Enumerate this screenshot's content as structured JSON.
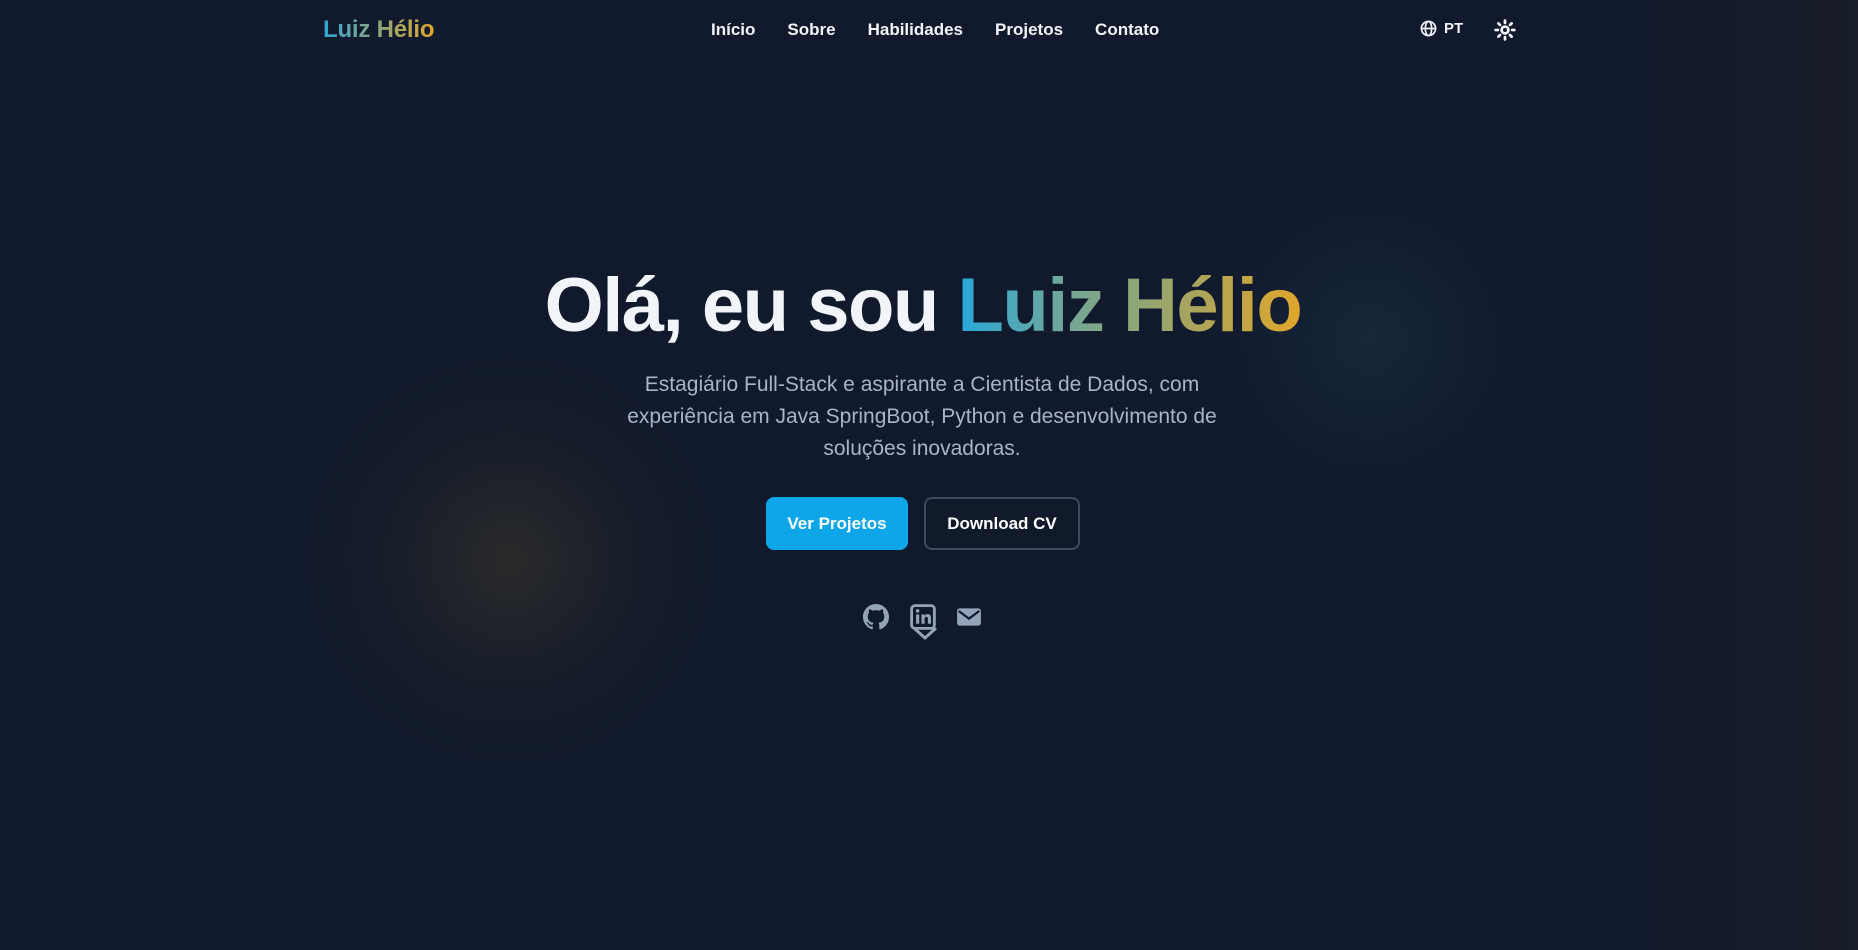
{
  "header": {
    "logo": "Luiz Hélio",
    "nav": [
      {
        "label": "Início"
      },
      {
        "label": "Sobre"
      },
      {
        "label": "Habilidades"
      },
      {
        "label": "Projetos"
      },
      {
        "label": "Contato"
      }
    ],
    "language": "PT",
    "language_icon": "globe-icon",
    "theme_icon": "sun-icon"
  },
  "hero": {
    "greeting": "Olá, eu sou",
    "name": "Luiz Hélio",
    "subtitle": "Estagiário Full-Stack e aspirante a Cientista de Dados, com experiência em Java SpringBoot, Python e desenvolvimento de soluções inovadoras.",
    "primary_button": "Ver Projetos",
    "secondary_button": "Download CV",
    "social_icons": [
      "github-icon",
      "linkedin-icon",
      "email-icon"
    ],
    "scroll_icon": "chevron-down-icon"
  },
  "colors": {
    "background": "#111a2c",
    "accent": "#0ea5e9",
    "gradient_start": "#2ea6d6",
    "gradient_end": "#e0a72c",
    "text": "#f1f5f9",
    "muted_text": "#a9b5c7",
    "icon": "#94a3b8"
  }
}
